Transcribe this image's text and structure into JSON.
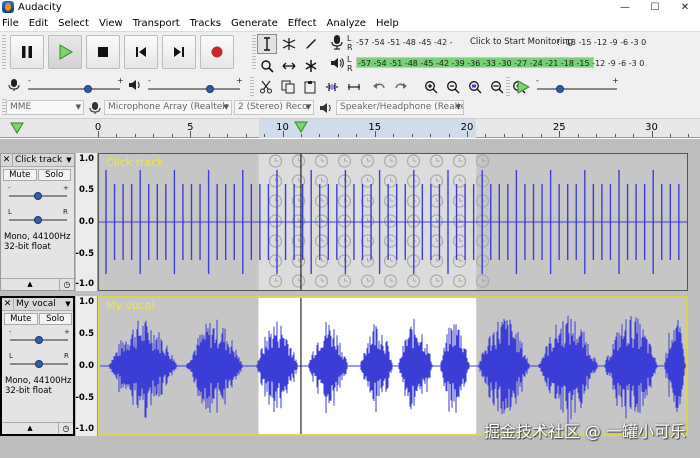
{
  "window": {
    "title": "Audacity",
    "controls": [
      "—",
      "☐",
      "✕"
    ]
  },
  "menu": [
    "File",
    "Edit",
    "Select",
    "View",
    "Transport",
    "Tracks",
    "Generate",
    "Effect",
    "Analyze",
    "Help"
  ],
  "meters": {
    "record_scale": "-57 -54 -51 -48 -45 -42 -",
    "record_prompt": "Click to Start Monitoring",
    "record_scale_right": "! -18 -15 -12  -9  -6  -3  0",
    "play_scale": "-57 -54 -51 -48 -45 -42 -39 -36 -33 -30 -27 -24 -21 -18 -15 -12  -9  -6  -3  0",
    "channel_left": "L",
    "channel_right": "R"
  },
  "sliders": {
    "minus": "-",
    "plus": "+"
  },
  "device": {
    "host": "MME",
    "recording_device": "Microphone Array (Realtek",
    "channels": "2 (Stereo) Recor",
    "playback_device": "Speaker/Headphone (Realte"
  },
  "ruler": {
    "labels": [
      "0",
      "5",
      "10",
      "15",
      "20",
      "25",
      "30"
    ],
    "selection_start_seconds": 8.7,
    "selection_end_seconds": 20.5,
    "playhead_seconds": 11
  },
  "tracks": [
    {
      "name": "Click track",
      "mute": "Mute",
      "solo": "Solo",
      "gain_min": "-",
      "gain_max": "+",
      "pan_left": "L",
      "pan_right": "R",
      "format_line1": "Mono, 44100Hz",
      "format_line2": "32-bit float",
      "scale_top": "1.0",
      "scale_mid": "0.0",
      "scale_bottom": "-1.0",
      "scale_upper_mid": "0.5",
      "scale_lower_mid": "-0.5",
      "label_color": "#f2e838"
    },
    {
      "name": "My vocal",
      "mute": "Mute",
      "solo": "Solo",
      "gain_min": "-",
      "gain_max": "+",
      "pan_left": "L",
      "pan_right": "R",
      "format_line1": "Mono, 44100Hz",
      "format_line2": "32-bit float",
      "scale_top": "1.0",
      "scale_mid": "0.0",
      "scale_bottom": "-1.0",
      "scale_upper_mid": "0.5",
      "scale_lower_mid": "-0.5",
      "label_color": "#f2e838"
    }
  ],
  "colors": {
    "waveform": "#3a3ed6",
    "selection": "#ffffff",
    "track_bg": "#c6c6c6",
    "meter_green": "#76d275"
  },
  "watermark": "掘金技术社区 @ 一罐小可乐"
}
